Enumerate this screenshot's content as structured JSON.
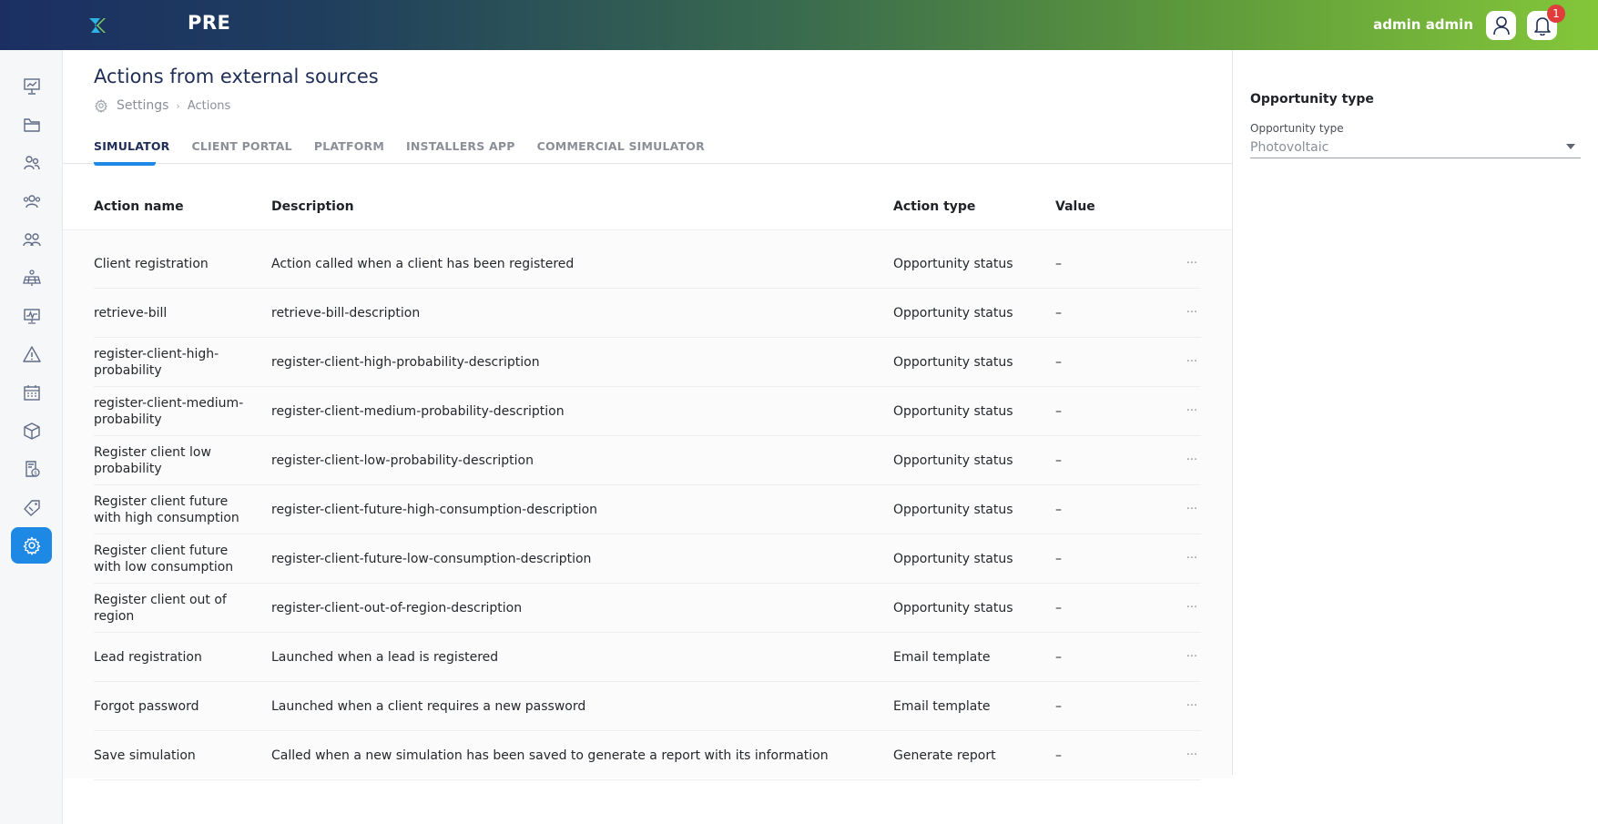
{
  "header": {
    "app_name": "PRE",
    "user_name": "admin admin",
    "notification_count": "1"
  },
  "sidebar": {
    "items": [
      {
        "icon": "presentation-icon",
        "active": false
      },
      {
        "icon": "folder-icon",
        "active": false
      },
      {
        "icon": "client-icon",
        "active": false
      },
      {
        "icon": "team-icon",
        "active": false
      },
      {
        "icon": "users-icon",
        "active": false
      },
      {
        "icon": "solar-panel-icon",
        "active": false
      },
      {
        "icon": "monitor-chart-icon",
        "active": false
      },
      {
        "icon": "warning-icon",
        "active": false
      },
      {
        "icon": "calendar-icon",
        "active": false
      },
      {
        "icon": "box-icon",
        "active": false
      },
      {
        "icon": "invoice-icon",
        "active": false
      },
      {
        "icon": "tag-icon",
        "active": false
      },
      {
        "icon": "settings-gear-icon",
        "active": true
      }
    ]
  },
  "page": {
    "title": "Actions from external sources",
    "breadcrumb": {
      "parent": "Settings",
      "separator": "›",
      "current": "Actions"
    }
  },
  "tabs": [
    {
      "label": "SIMULATOR",
      "active": true
    },
    {
      "label": "CLIENT PORTAL",
      "active": false
    },
    {
      "label": "PLATFORM",
      "active": false
    },
    {
      "label": "INSTALLERS APP",
      "active": false
    },
    {
      "label": "COMMERCIAL SIMULATOR",
      "active": false
    }
  ],
  "table": {
    "columns": {
      "name": "Action name",
      "description": "Description",
      "type": "Action type",
      "value": "Value"
    },
    "rows": [
      {
        "name": "Client registration",
        "description": "Action called when a client has been registered",
        "type": "Opportunity status",
        "value": "–",
        "more": "···"
      },
      {
        "name": "retrieve-bill",
        "description": "retrieve-bill-description",
        "type": "Opportunity status",
        "value": "–",
        "more": "···"
      },
      {
        "name": "register-client-high-probability",
        "description": "register-client-high-probability-description",
        "type": "Opportunity status",
        "value": "–",
        "more": "···"
      },
      {
        "name": "register-client-medium-probability",
        "description": "register-client-medium-probability-description",
        "type": "Opportunity status",
        "value": "–",
        "more": "···"
      },
      {
        "name": "Register client low probability",
        "description": "register-client-low-probability-description",
        "type": "Opportunity status",
        "value": "–",
        "more": "···"
      },
      {
        "name": "Register client future with high consumption",
        "description": "register-client-future-high-consumption-description",
        "type": "Opportunity status",
        "value": "–",
        "more": "···"
      },
      {
        "name": "Register client future with low consumption",
        "description": "register-client-future-low-consumption-description",
        "type": "Opportunity status",
        "value": "–",
        "more": "···"
      },
      {
        "name": "Register client out of region",
        "description": "register-client-out-of-region-description",
        "type": "Opportunity status",
        "value": "–",
        "more": "···"
      },
      {
        "name": "Lead registration",
        "description": "Launched when a lead is registered",
        "type": "Email template",
        "value": "–",
        "more": "···"
      },
      {
        "name": "Forgot password",
        "description": "Launched when a client requires a new password",
        "type": "Email template",
        "value": "–",
        "more": "···"
      },
      {
        "name": "Save simulation",
        "description": "Called when a new simulation has been saved to generate a report with its information",
        "type": "Generate report",
        "value": "–",
        "more": "···"
      }
    ]
  },
  "panel": {
    "title": "Opportunity type",
    "field_label": "Opportunity type",
    "select_value": "Photovoltaic"
  },
  "colors": {
    "accent": "#1e88e5",
    "header_gradient_start": "#1b2f63",
    "header_gradient_end": "#84c63a",
    "badge": "#e03c3c"
  }
}
